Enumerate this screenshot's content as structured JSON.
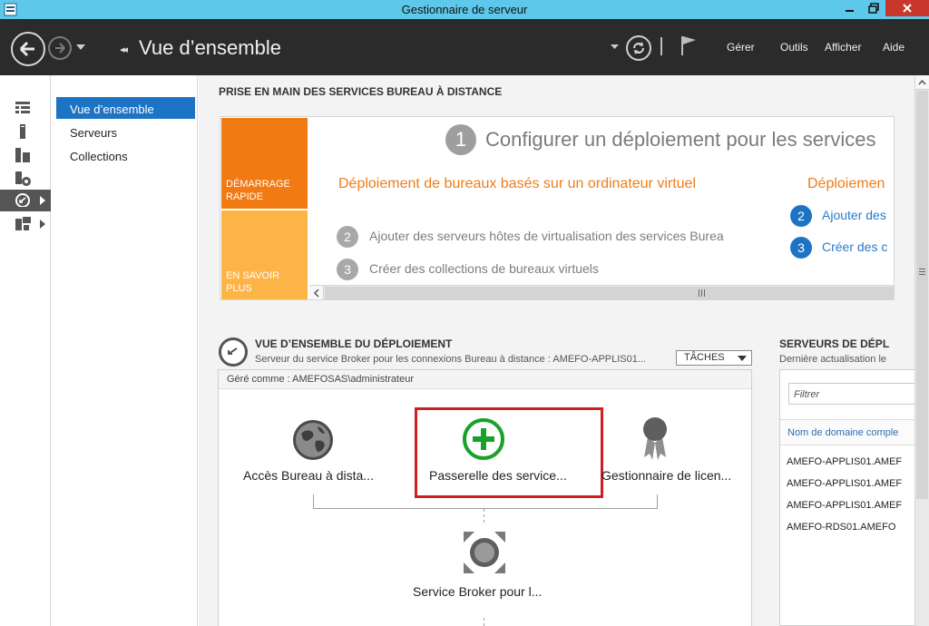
{
  "window": {
    "title": "Gestionnaire de serveur",
    "titlebar_color": "#5ec8ea",
    "close_color": "#c7372b"
  },
  "header": {
    "page_title": "Vue d’ensemble",
    "menu": [
      "Gérer",
      "Outils",
      "Afficher",
      "Aide"
    ]
  },
  "rail": {
    "icons": [
      "dashboard-icon",
      "local-server-icon",
      "all-servers-icon",
      "file-storage-icon",
      "remote-desktop-icon",
      "iis-icon"
    ]
  },
  "subnav": {
    "items": [
      "Vue d’ensemble",
      "Serveurs",
      "Collections"
    ],
    "active_color": "#1e74c4"
  },
  "quickstart": {
    "section_title": "PRISE EN MAIN DES SERVICES BUREAU À DISTANCE",
    "tile_quick": "DÉMARRAGE RAPIDE",
    "tile_learn": "EN SAVOIR PLUS",
    "step1_number": "1",
    "step1_title": "Configurer un déploiement pour les services",
    "left_heading": "Déploiement de bureaux basés sur un ordinateur virtuel",
    "left_steps": [
      {
        "num": "2",
        "text": "Ajouter des serveurs hôtes de virtualisation des services Burea"
      },
      {
        "num": "3",
        "text": "Créer des collections de bureaux virtuels"
      }
    ],
    "right_heading": "Déploiemen",
    "right_steps": [
      {
        "num": "2",
        "text": "Ajouter des"
      },
      {
        "num": "3",
        "text": "Créer des c"
      }
    ],
    "accent_orange": "#f27a12",
    "accent_light_orange": "#fdb447"
  },
  "deployment": {
    "section_title": "VUE D’ENSEMBLE DU DÉPLOIEMENT",
    "subtitle": "Serveur du service Broker pour les connexions Bureau à distance : AMEFO-APPLIS01...",
    "tasks_label": "TÂCHES",
    "managed_as": "Géré comme : AMEFOSAS\\administrateur",
    "roles": {
      "web_access": "Accès Bureau à dista...",
      "gateway": "Passerelle des service...",
      "licensing": "Gestionnaire de licen...",
      "broker": "Service Broker pour l..."
    },
    "highlight_color": "#d21d24",
    "gateway_color": "#1aa12a"
  },
  "servers": {
    "section_title": "SERVEURS DE DÉPL",
    "subtitle": "Dernière actualisation le",
    "filter_placeholder": "Filtrer",
    "column_header": "Nom de domaine comple",
    "rows": [
      "AMEFO-APPLIS01.AMEF",
      "AMEFO-APPLIS01.AMEF",
      "AMEFO-APPLIS01.AMEF",
      "AMEFO-RDS01.AMEFO"
    ]
  }
}
